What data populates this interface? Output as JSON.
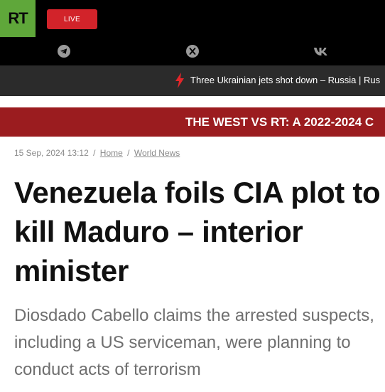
{
  "header": {
    "logo_text": "RT",
    "live_label": "LIVE",
    "social": [
      {
        "icon": "telegram-icon"
      },
      {
        "icon": "x-icon"
      },
      {
        "icon": "vk-icon"
      }
    ]
  },
  "ticker": {
    "icon": "lightning-icon",
    "text": "Three Ukrainian jets shot down – Russia | Rus"
  },
  "promo": {
    "text": "THE WEST VS RT: A 2022-2024 C"
  },
  "article": {
    "date": "15 Sep, 2024 13:12",
    "breadcrumb_sep": "/",
    "breadcrumbs": [
      "Home",
      "World News"
    ],
    "headline": "Venezuela foils CIA plot to kill Maduro – interior minister",
    "summary": "Diosdado Cabello claims the arrested suspects, including a US serviceman, were planning to conduct acts of terrorism"
  },
  "colors": {
    "logo_green": "#5fa73a",
    "live_red": "#d2232a",
    "promo_red": "#9b1c1f",
    "ticker_bg": "#2b2b2b"
  }
}
